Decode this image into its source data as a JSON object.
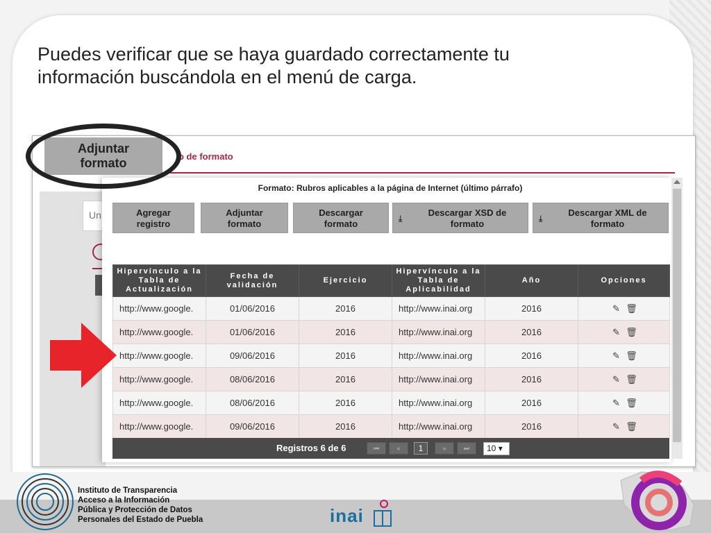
{
  "headline": {
    "line1": "Puedes verificar que se haya guardado correctamente tu",
    "line2": "información buscándola en el menú de carga."
  },
  "background_ui": {
    "tab_label_fragment": "o de formato",
    "input_fragment": "Un"
  },
  "callout_button": {
    "line1": "Adjuntar",
    "line2": "formato"
  },
  "modal": {
    "title": "Formato: Rubros aplicables a la página de Internet (último párrafo)",
    "buttons": [
      {
        "line1": "Agregar",
        "line2": "registro"
      },
      {
        "line1": "Adjuntar",
        "line2": "formato"
      },
      {
        "line1": "Descargar",
        "line2": "formato"
      },
      {
        "line1": "Descargar XSD de",
        "line2": "formato"
      },
      {
        "line1": "Descargar XML de",
        "line2": "formato"
      }
    ],
    "download_icon": "download-icon",
    "table": {
      "headers": [
        "Hipervínculo a la Tabla de Actualización",
        "Fecha de validación",
        "Ejercicio",
        "Hipervínculo a la Tabla de Aplicabilidad",
        "Año",
        "Opciones"
      ],
      "rows": [
        {
          "link1": "http://www.google.",
          "fecha": "01/06/2016",
          "ejercicio": "2016",
          "link2": "http://www.inai.org",
          "anio": "2016"
        },
        {
          "link1": "http://www.google.",
          "fecha": "01/06/2016",
          "ejercicio": "2016",
          "link2": "http://www.inai.org",
          "anio": "2016"
        },
        {
          "link1": "http://www.google.",
          "fecha": "09/06/2016",
          "ejercicio": "2016",
          "link2": "http://www.inai.org",
          "anio": "2016"
        },
        {
          "link1": "http://www.google.",
          "fecha": "08/06/2016",
          "ejercicio": "2016",
          "link2": "http://www.inai.org",
          "anio": "2016"
        },
        {
          "link1": "http://www.google.",
          "fecha": "08/06/2016",
          "ejercicio": "2016",
          "link2": "http://www.inai.org",
          "anio": "2016"
        },
        {
          "link1": "http://www.google.",
          "fecha": "09/06/2016",
          "ejercicio": "2016",
          "link2": "http://www.inai.org",
          "anio": "2016"
        }
      ],
      "row_icons": [
        "pencil-icon",
        "trash-icon"
      ]
    },
    "pager": {
      "records_text": "Registros 6 de 6",
      "current_page": "1",
      "page_size": "10"
    }
  },
  "footer": {
    "institution_lines": [
      "Instituto de Transparencia",
      "Acceso a la Información",
      "Pública y Protección de Datos",
      "Personales del Estado de Puebla"
    ],
    "brand": "inai"
  },
  "colors": {
    "accent": "#9b2b45",
    "table_header": "#4a4a4a",
    "arrow": "#e8242b",
    "button_gray": "#a9a9a9",
    "row_alt": "#f2e5e6"
  }
}
